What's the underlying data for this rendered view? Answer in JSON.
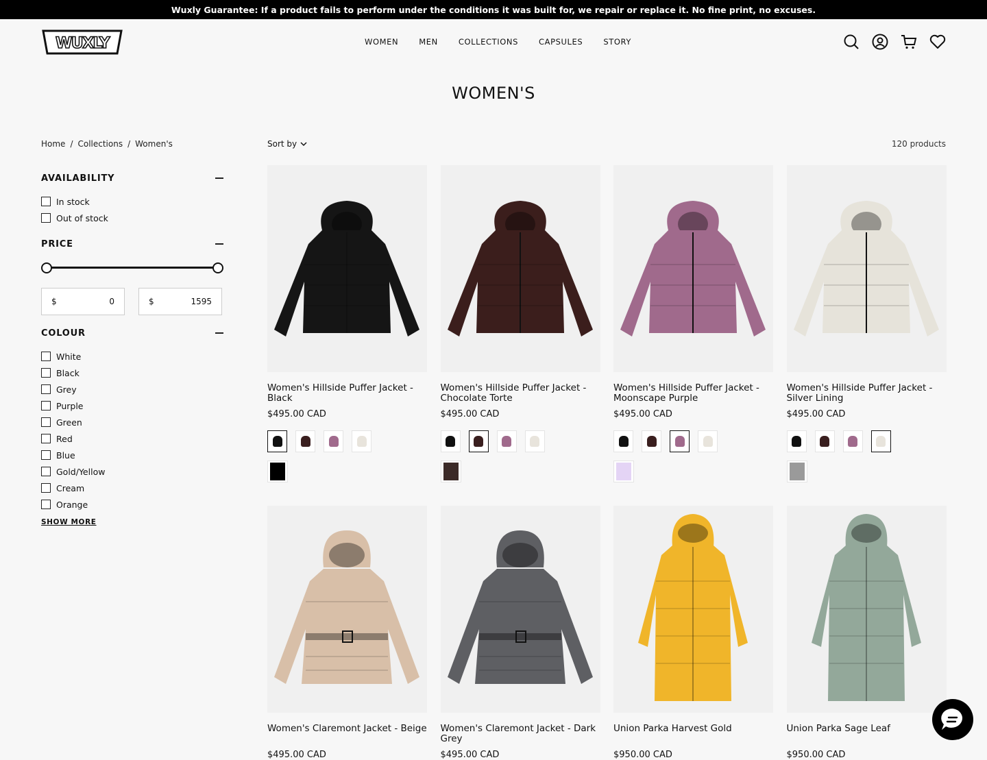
{
  "announcement": "Wuxly Guarantee: If a product fails to perform under the conditions it was built for, we repair or replace it. No fine print, no excuses.",
  "brand": "WUXLY",
  "nav": [
    "WOMEN",
    "MEN",
    "COLLECTIONS",
    "CAPSULES",
    "STORY"
  ],
  "header_icons": [
    "search-icon",
    "account-icon",
    "cart-icon",
    "wishlist-icon"
  ],
  "page_title": "WOMEN'S",
  "breadcrumb": [
    "Home",
    "/",
    "Collections",
    "/",
    "Women's"
  ],
  "sort_label": "Sort by",
  "product_count": "120 products",
  "filters": {
    "availability": {
      "title": "AVAILABILITY",
      "options": [
        "In stock",
        "Out of stock"
      ]
    },
    "price": {
      "title": "PRICE",
      "currency": "$",
      "min": "0",
      "max": "1595",
      "range_low_fraction": 0,
      "range_high_fraction": 1
    },
    "colour": {
      "title": "COLOUR",
      "options": [
        "White",
        "Black",
        "Grey",
        "Purple",
        "Green",
        "Red",
        "Blue",
        "Gold/Yellow",
        "Cream",
        "Orange"
      ],
      "show_more": "SHOW MORE"
    }
  },
  "swatch_colors": [
    "#111111",
    "#3a1f1f",
    "#a06a8c",
    "#e8e4dc"
  ],
  "products": [
    {
      "name": "Women's Hillside Puffer Jacket - Black",
      "price": "$495.00 CAD",
      "selected_swatch": 0,
      "color_chip": "#000000",
      "garment_color": "#151515",
      "kind": "jacket"
    },
    {
      "name": "Women's Hillside Puffer Jacket - Chocolate Torte",
      "price": "$495.00 CAD",
      "selected_swatch": 1,
      "color_chip": "#3b2a27",
      "garment_color": "#3b1e1c",
      "kind": "jacket"
    },
    {
      "name": "Women's Hillside Puffer Jacket - Moonscape Purple",
      "price": "$495.00 CAD",
      "selected_swatch": 2,
      "color_chip": "#e4d4f5",
      "garment_color": "#a06a8c",
      "kind": "jacket"
    },
    {
      "name": "Women's Hillside Puffer Jacket - Silver Lining",
      "price": "$495.00 CAD",
      "selected_swatch": 3,
      "color_chip": "#9a9a9a",
      "garment_color": "#e6e3da",
      "kind": "jacket"
    },
    {
      "name": "Women's Claremont Jacket - Beige",
      "price": "$495.00 CAD",
      "garment_color": "#d8bfa8",
      "kind": "belted"
    },
    {
      "name": "Women's Claremont Jacket - Dark Grey",
      "price": "$495.00 CAD",
      "garment_color": "#5e5f63",
      "kind": "belted"
    },
    {
      "name": "Union Parka Harvest Gold",
      "price": "$950.00 CAD",
      "garment_color": "#f0b52a",
      "kind": "parka"
    },
    {
      "name": "Union Parka Sage Leaf",
      "price": "$950.00 CAD",
      "garment_color": "#93a89a",
      "kind": "parka"
    }
  ]
}
